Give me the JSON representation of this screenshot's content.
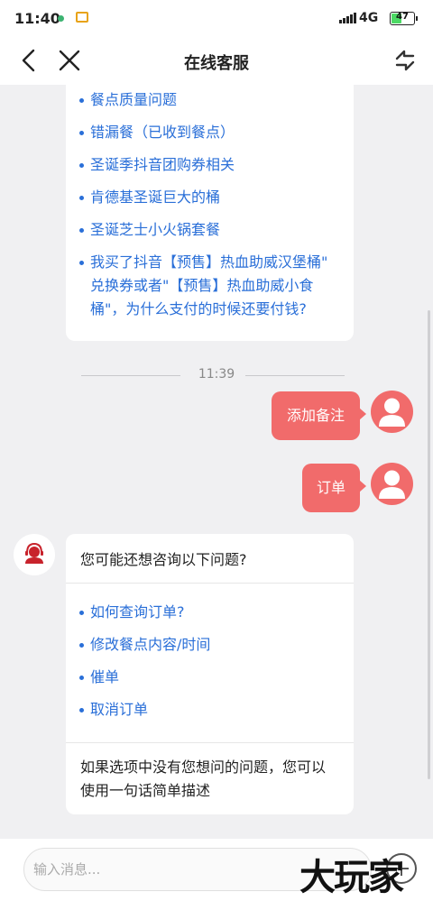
{
  "status_bar": {
    "time": "11:40",
    "network": "4G",
    "battery": "47",
    "battery_level": 0.47
  },
  "header": {
    "title": "在线客服"
  },
  "chat": {
    "top_links": [
      "餐点质量问题",
      "错漏餐（已收到餐点）",
      "圣诞季抖音团购券相关",
      "肯德基圣诞巨大的桶",
      "圣诞芝士小火锅套餐",
      "我买了抖音【预售】热血助威汉堡桶\" 兑换券或者\"【预售】热血助威小食桶\"，为什么支付的时候还要付钱?"
    ],
    "timestamp": "11:39",
    "user_messages": [
      "添加备注",
      "订单"
    ],
    "agent_card": {
      "question": "您可能还想咨询以下问题?",
      "options": [
        "如何查询订单?",
        "修改餐点内容/时间",
        "催单",
        "取消订单"
      ],
      "footer": "如果选项中没有您想问的问题，您可以使用一句话简单描述"
    }
  },
  "input": {
    "placeholder": "输入消息..."
  },
  "watermark": "大玩家",
  "colors": {
    "accent": "#f16b6b",
    "link": "#2a6fd8",
    "background": "#f0f0f2"
  }
}
